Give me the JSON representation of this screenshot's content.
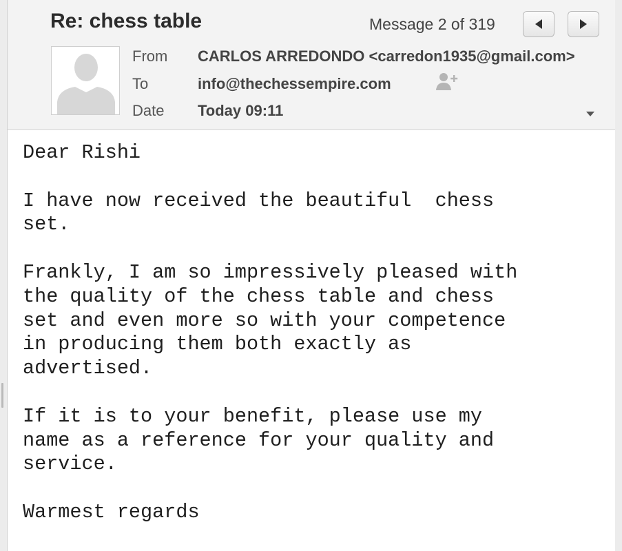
{
  "message": {
    "subject": "Re: chess table",
    "counter": "Message 2 of 319",
    "from_label": "From",
    "from_value": "CARLOS ARREDONDO <carredon1935@gmail.com>",
    "to_label": "To",
    "to_value": "info@thechessempire.com",
    "date_label": "Date",
    "date_value": "Today 09:11"
  },
  "icons": {
    "prev": "triangle-left-icon",
    "next": "triangle-right-icon",
    "avatar": "default-person-icon",
    "add_contact": "add-person-icon",
    "expand": "chevron-down-icon"
  },
  "body": {
    "text": "Dear Rishi\n\nI have now received the beautiful  chess\nset.\n\nFrankly, I am so impressively pleased with\nthe quality of the chess table and chess\nset and even more so with your competence\nin producing them both exactly as\nadvertised.\n\nIf it is to your benefit, please use my\nname as a reference for your quality and\nservice.\n\nWarmest regards"
  }
}
